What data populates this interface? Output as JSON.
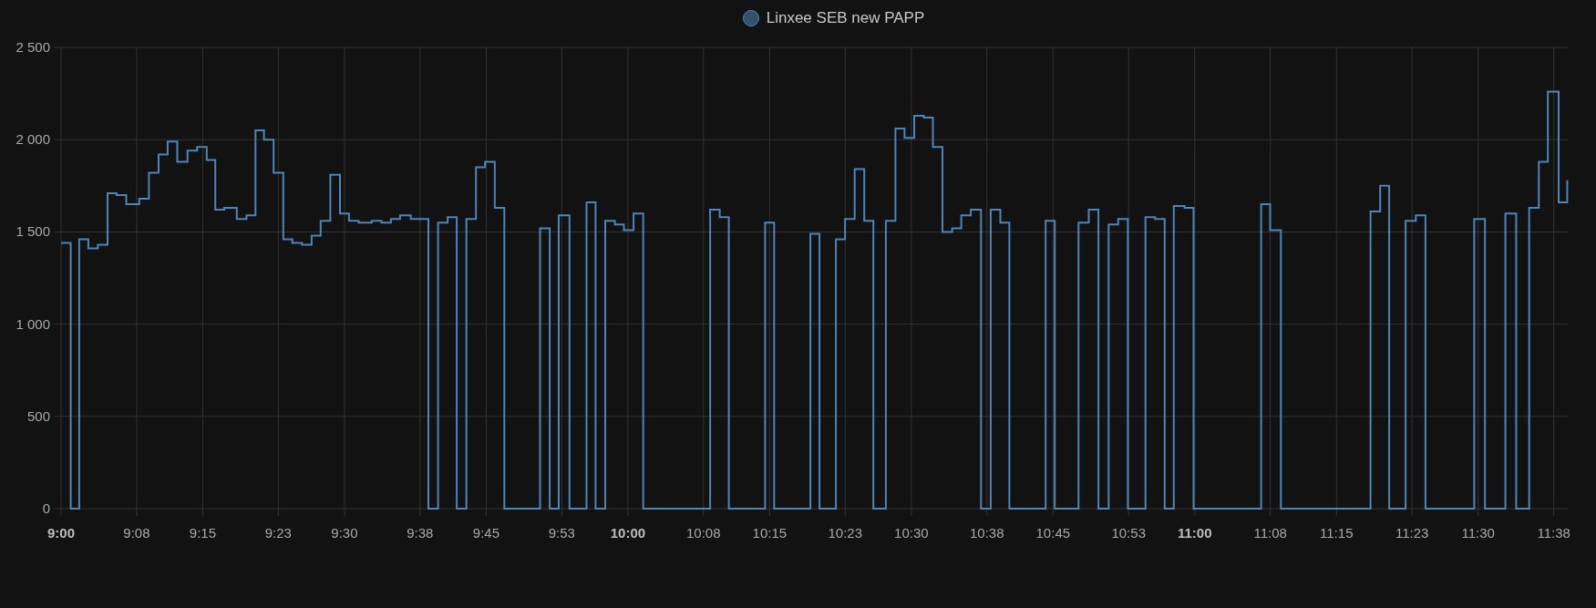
{
  "chart": {
    "chart_data": {
      "type": "line",
      "grid": true,
      "x": [
        9,
        9.017,
        9.017,
        9.032,
        9.032,
        9.048,
        9.048,
        9.065,
        9.065,
        9.082,
        9.082,
        9.098,
        9.098,
        9.115,
        9.115,
        9.138,
        9.138,
        9.155,
        9.155,
        9.172,
        9.172,
        9.188,
        9.188,
        9.205,
        9.205,
        9.223,
        9.223,
        9.24,
        9.24,
        9.257,
        9.257,
        9.272,
        9.272,
        9.288,
        9.288,
        9.31,
        9.31,
        9.327,
        9.327,
        9.343,
        9.343,
        9.358,
        9.358,
        9.375,
        9.375,
        9.392,
        9.392,
        9.408,
        9.408,
        9.425,
        9.425,
        9.442,
        9.442,
        9.458,
        9.458,
        9.475,
        9.475,
        9.492,
        9.492,
        9.508,
        9.508,
        9.525,
        9.525,
        9.548,
        9.548,
        9.565,
        9.565,
        9.582,
        9.582,
        9.598,
        9.598,
        9.617,
        9.617,
        9.648,
        9.648,
        9.665,
        9.665,
        9.682,
        9.682,
        9.698,
        9.698,
        9.715,
        9.715,
        9.732,
        9.732,
        9.748,
        9.748,
        9.765,
        9.765,
        9.782,
        9.782,
        9.845,
        9.845,
        9.862,
        9.862,
        9.878,
        9.878,
        9.897,
        9.897,
        9.927,
        9.927,
        9.943,
        9.943,
        9.96,
        9.96,
        9.977,
        9.977,
        9.993,
        9.993,
        10.01,
        10.01,
        10.027,
        10.027,
        10.145,
        10.145,
        10.162,
        10.162,
        10.178,
        10.178,
        10.242,
        10.242,
        10.258,
        10.258,
        10.322,
        10.322,
        10.338,
        10.338,
        10.367,
        10.367,
        10.383,
        10.383,
        10.4,
        10.4,
        10.417,
        10.417,
        10.433,
        10.433,
        10.455,
        10.455,
        10.472,
        10.472,
        10.488,
        10.488,
        10.505,
        10.505,
        10.522,
        10.522,
        10.538,
        10.538,
        10.555,
        10.555,
        10.572,
        10.572,
        10.588,
        10.588,
        10.605,
        10.605,
        10.623,
        10.623,
        10.64,
        10.64,
        10.657,
        10.657,
        10.673,
        10.673,
        10.737,
        10.737,
        10.753,
        10.753,
        10.795,
        10.795,
        10.813,
        10.813,
        10.83,
        10.83,
        10.848,
        10.848,
        10.865,
        10.865,
        10.882,
        10.882,
        10.913,
        10.913,
        10.93,
        10.93,
        10.947,
        10.947,
        10.963,
        10.963,
        10.982,
        10.982,
        10.998,
        10.998,
        11.117,
        11.117,
        11.133,
        11.133,
        11.152,
        11.152,
        11.31,
        11.31,
        11.327,
        11.327,
        11.343,
        11.343,
        11.372,
        11.372,
        11.39,
        11.39,
        11.407,
        11.407,
        11.493,
        11.493,
        11.512,
        11.512,
        11.548,
        11.548,
        11.567,
        11.567,
        11.59,
        11.59,
        11.607,
        11.607,
        11.623,
        11.623,
        11.642,
        11.642,
        11.657,
        11.657
      ],
      "series": [
        {
          "name": "Linxee SEB new PAPP",
          "color": "#4e84b8",
          "values": [
            1440,
            1440,
            0,
            0,
            1460,
            1460,
            1410,
            1410,
            1430,
            1430,
            1710,
            1710,
            1700,
            1700,
            1650,
            1650,
            1680,
            1680,
            1820,
            1820,
            1920,
            1920,
            1990,
            1990,
            1880,
            1880,
            1940,
            1940,
            1960,
            1960,
            1890,
            1890,
            1620,
            1620,
            1630,
            1630,
            1570,
            1570,
            1590,
            1590,
            2050,
            2050,
            2000,
            2000,
            1820,
            1820,
            1460,
            1460,
            1440,
            1440,
            1430,
            1430,
            1480,
            1480,
            1560,
            1560,
            1810,
            1810,
            1600,
            1600,
            1560,
            1560,
            1550,
            1550,
            1560,
            1560,
            1550,
            1550,
            1570,
            1570,
            1590,
            1590,
            1570,
            1570,
            0,
            0,
            1550,
            1550,
            1580,
            1580,
            0,
            0,
            1570,
            1570,
            1850,
            1850,
            1880,
            1880,
            1630,
            1630,
            0,
            0,
            1520,
            1520,
            0,
            0,
            1590,
            1590,
            0,
            0,
            1660,
            1660,
            0,
            0,
            1560,
            1560,
            1540,
            1540,
            1510,
            1510,
            1600,
            1600,
            0,
            0,
            1620,
            1620,
            1580,
            1580,
            0,
            0,
            1550,
            1550,
            0,
            0,
            1490,
            1490,
            0,
            0,
            1460,
            1460,
            1570,
            1570,
            1840,
            1840,
            1560,
            1560,
            0,
            0,
            1560,
            1560,
            2060,
            2060,
            2010,
            2010,
            2130,
            2130,
            2120,
            2120,
            1960,
            1960,
            1500,
            1500,
            1520,
            1520,
            1590,
            1590,
            1620,
            1620,
            0,
            0,
            1620,
            1620,
            1550,
            1550,
            0,
            0,
            1560,
            1560,
            0,
            0,
            1550,
            1550,
            1620,
            1620,
            0,
            0,
            1540,
            1540,
            1570,
            1570,
            0,
            0,
            1580,
            1580,
            1570,
            1570,
            0,
            0,
            1640,
            1640,
            1630,
            1630,
            0,
            0,
            1650,
            1650,
            1510,
            1510,
            0,
            0,
            1610,
            1610,
            1750,
            1750,
            0,
            0,
            1560,
            1560,
            1590,
            1590,
            0,
            0,
            1570,
            1570,
            0,
            0,
            1600,
            1600,
            0,
            0,
            1630,
            1630,
            1880,
            1880,
            2260,
            2260,
            1660,
            1660,
            1780
          ]
        }
      ],
      "xlim": [
        9,
        11.658
      ],
      "ylim": [
        0,
        2500
      ],
      "xticks": [
        {
          "value": 9,
          "label": "9:00"
        },
        {
          "value": 9.1333,
          "label": "9:08"
        },
        {
          "value": 9.25,
          "label": "9:15"
        },
        {
          "value": 9.3833,
          "label": "9:23"
        },
        {
          "value": 9.5,
          "label": "9:30"
        },
        {
          "value": 9.6333,
          "label": "9:38"
        },
        {
          "value": 9.75,
          "label": "9:45"
        },
        {
          "value": 9.8833,
          "label": "9:53"
        },
        {
          "value": 10,
          "label": "10:00"
        },
        {
          "value": 10.1333,
          "label": "10:08"
        },
        {
          "value": 10.25,
          "label": "10:15"
        },
        {
          "value": 10.3833,
          "label": "10:23"
        },
        {
          "value": 10.5,
          "label": "10:30"
        },
        {
          "value": 10.6333,
          "label": "10:38"
        },
        {
          "value": 10.75,
          "label": "10:45"
        },
        {
          "value": 10.8833,
          "label": "10:53"
        },
        {
          "value": 11,
          "label": "11:00"
        },
        {
          "value": 11.1333,
          "label": "11:08"
        },
        {
          "value": 11.25,
          "label": "11:15"
        },
        {
          "value": 11.3833,
          "label": "11:23"
        },
        {
          "value": 11.5,
          "label": "11:30"
        },
        {
          "value": 11.6333,
          "label": "11:38"
        }
      ],
      "yticks": [
        {
          "value": 0,
          "label": "0"
        },
        {
          "value": 500,
          "label": "500"
        },
        {
          "value": 1000,
          "label": "1 000"
        },
        {
          "value": 1500,
          "label": "1 500"
        },
        {
          "value": 2000,
          "label": "2 000"
        },
        {
          "value": 2500,
          "label": "2 500"
        }
      ]
    }
  }
}
